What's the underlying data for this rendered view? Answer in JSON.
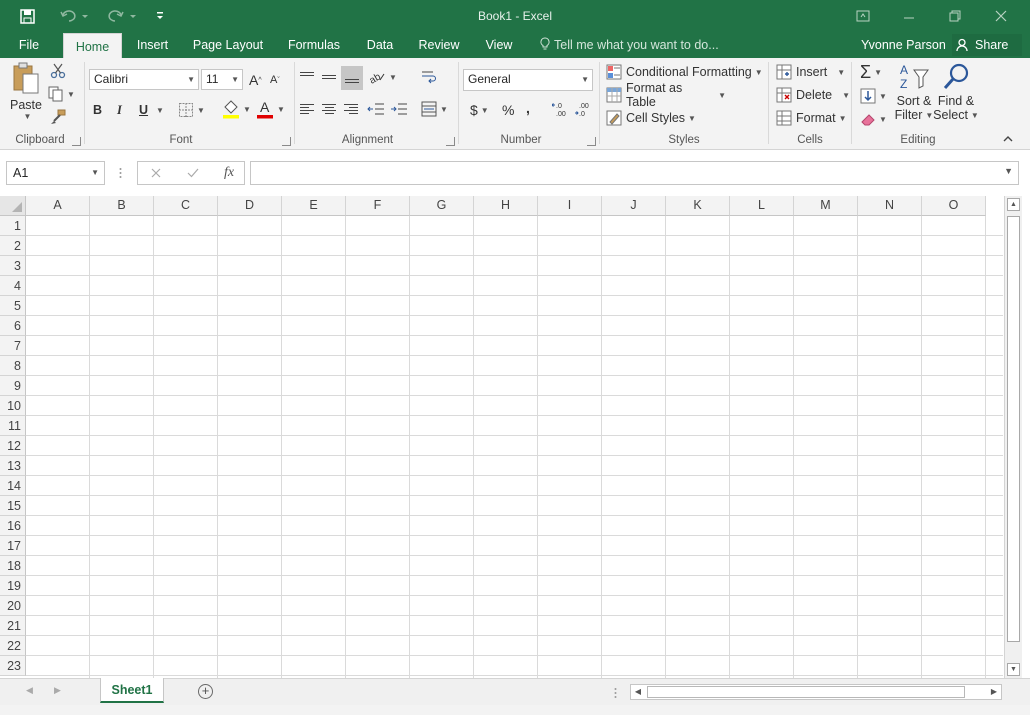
{
  "app": {
    "title": "Book1 - Excel"
  },
  "qat": {
    "save_icon": "save-icon",
    "undo_icon": "undo-icon",
    "redo_icon": "redo-icon",
    "customize_icon": "customize-qat-icon"
  },
  "tabs": [
    {
      "label": "File"
    },
    {
      "label": "Home",
      "active": true
    },
    {
      "label": "Insert"
    },
    {
      "label": "Page Layout"
    },
    {
      "label": "Formulas"
    },
    {
      "label": "Data"
    },
    {
      "label": "Review"
    },
    {
      "label": "View"
    }
  ],
  "tell_me": {
    "placeholder": "Tell me what you want to do..."
  },
  "user": {
    "name": "Yvonne Parson"
  },
  "share": {
    "label": "Share"
  },
  "ribbon": {
    "clipboard": {
      "label": "Clipboard",
      "paste": "Paste"
    },
    "font": {
      "label": "Font",
      "font_name": "Calibri",
      "font_size": "11",
      "bold": "B",
      "italic": "I",
      "underline": "U"
    },
    "alignment": {
      "label": "Alignment"
    },
    "number": {
      "label": "Number",
      "format": "General",
      "currency": "$",
      "percent": "%",
      "comma": ","
    },
    "styles": {
      "label": "Styles",
      "conditional_formatting": "Conditional Formatting",
      "format_as_table": "Format as Table",
      "cell_styles": "Cell Styles"
    },
    "cells": {
      "label": "Cells",
      "insert": "Insert",
      "delete": "Delete",
      "format": "Format"
    },
    "editing": {
      "label": "Editing",
      "sort_filter_1": "Sort &",
      "sort_filter_2": "Filter",
      "find_select_1": "Find &",
      "find_select_2": "Select"
    }
  },
  "formula_bar": {
    "name_box": "A1",
    "fx": "fx",
    "formula": ""
  },
  "grid": {
    "columns": [
      "A",
      "B",
      "C",
      "D",
      "E",
      "F",
      "G",
      "H",
      "I",
      "J",
      "K",
      "L",
      "M",
      "N",
      "O"
    ],
    "rows": [
      "1",
      "2",
      "3",
      "4",
      "5",
      "6",
      "7",
      "8",
      "9",
      "10",
      "11",
      "12",
      "13",
      "14",
      "15",
      "16",
      "17",
      "18",
      "19",
      "20",
      "21",
      "22",
      "23"
    ],
    "selected_cell": "A1"
  },
  "sheets": [
    {
      "name": "Sheet1",
      "active": true
    }
  ],
  "colors": {
    "brand": "#217346",
    "gridline": "#dadada"
  }
}
